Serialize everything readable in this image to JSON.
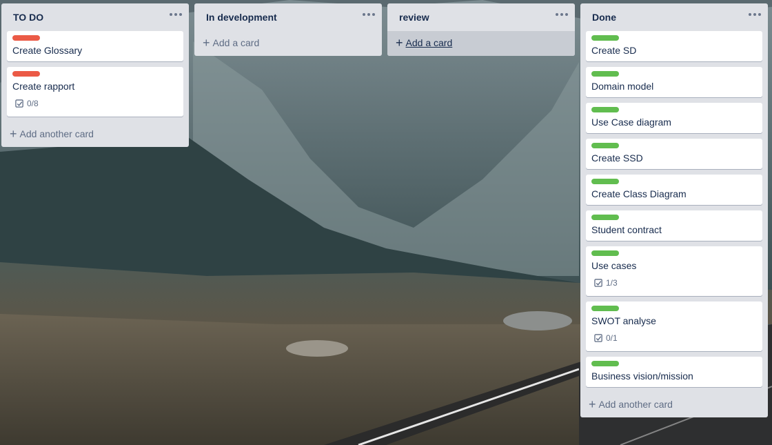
{
  "colors": {
    "red_label": "#eb5a46",
    "green_label": "#61bd4f",
    "list_bg": "#dfe1e6"
  },
  "lists": [
    {
      "title": "TO DO",
      "cards": [
        {
          "label_color": "red",
          "title": "Create Glossary"
        },
        {
          "label_color": "red",
          "title": "Create rapport",
          "checklist": "0/8"
        }
      ],
      "add_label": "Add another card"
    },
    {
      "title": "In development",
      "cards": [],
      "add_label": "Add a card"
    },
    {
      "title": "review",
      "cards": [],
      "add_label": "Add a card"
    },
    {
      "title": "Done",
      "cards": [
        {
          "label_color": "green",
          "title": "Create SD"
        },
        {
          "label_color": "green",
          "title": "Domain model"
        },
        {
          "label_color": "green",
          "title": "Use Case diagram"
        },
        {
          "label_color": "green",
          "title": "Create SSD"
        },
        {
          "label_color": "green",
          "title": "Create Class Diagram"
        },
        {
          "label_color": "green",
          "title": "Student contract"
        },
        {
          "label_color": "green",
          "title": "Use cases",
          "checklist": "1/3"
        },
        {
          "label_color": "green",
          "title": "SWOT analyse",
          "checklist": "0/1"
        },
        {
          "label_color": "green",
          "title": "Business vision/mission"
        }
      ],
      "add_label": "Add another card"
    }
  ]
}
